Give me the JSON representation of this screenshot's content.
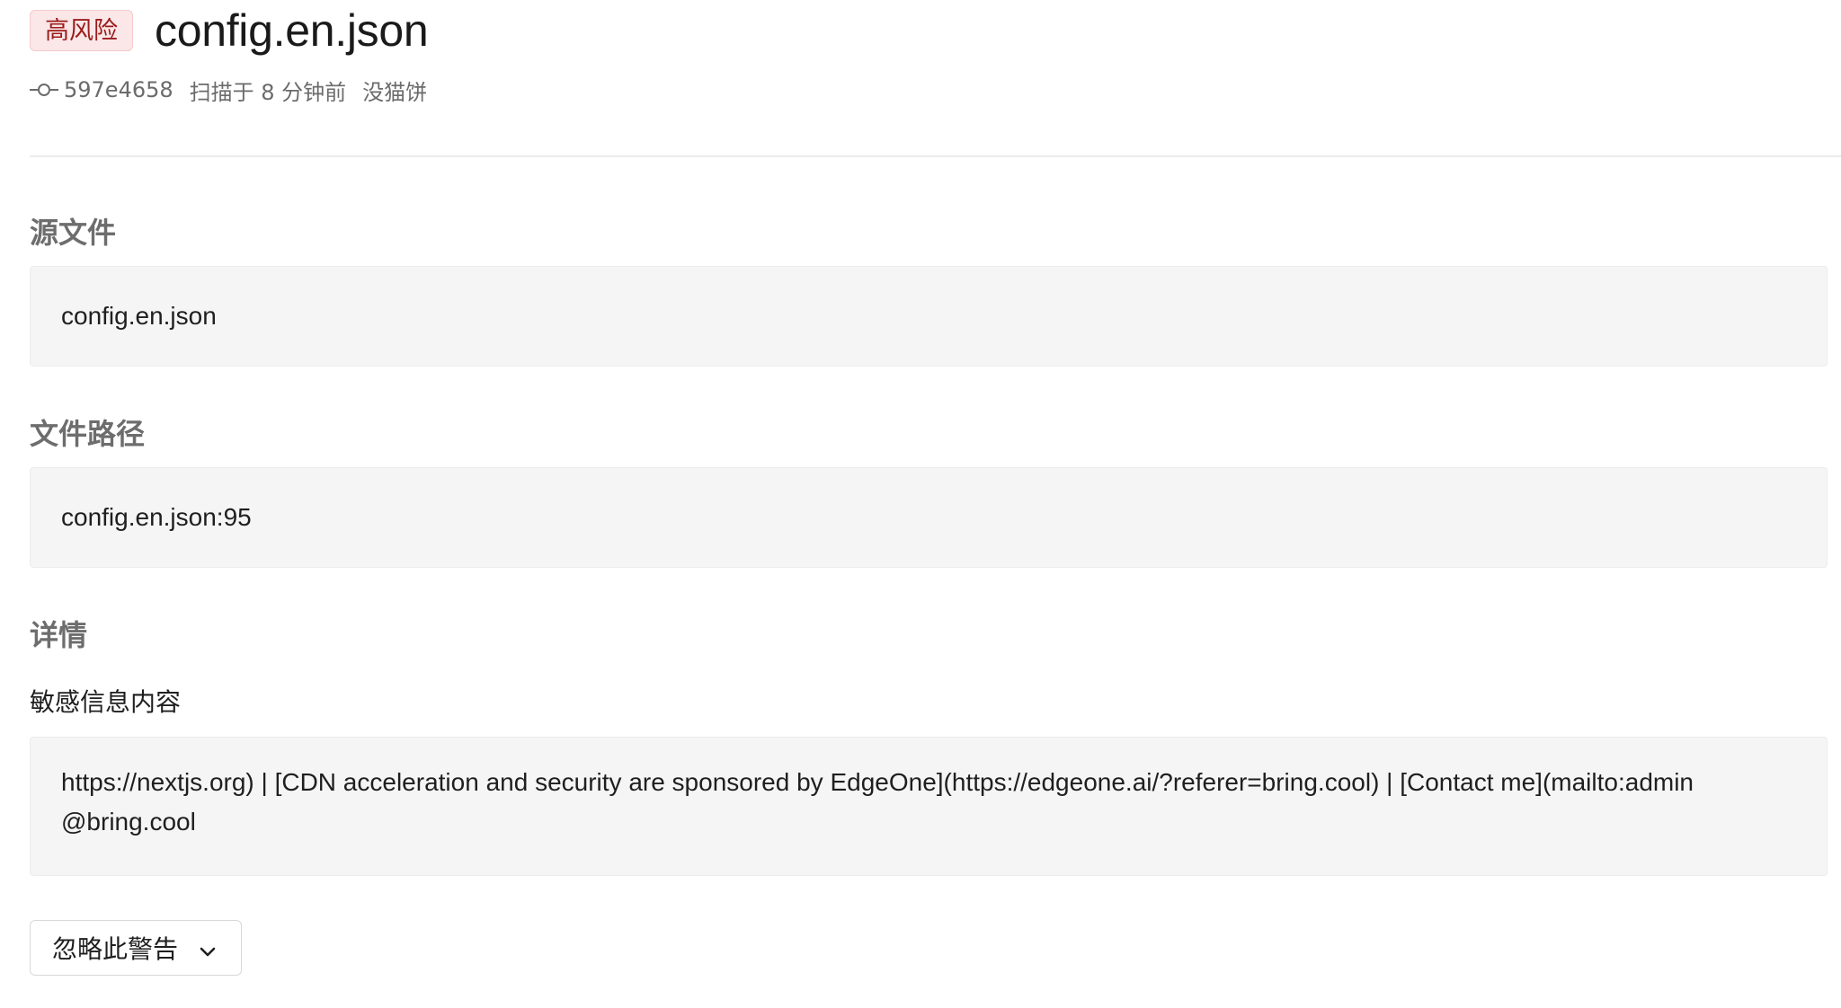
{
  "header": {
    "risk_badge": "高风险",
    "file_title": "config.en.json"
  },
  "meta": {
    "commit_icon": "commit-icon",
    "commit_hash": "597e4658",
    "scanned": "扫描于 8 分钟前",
    "author": "没猫饼"
  },
  "sections": {
    "source_file": {
      "title": "源文件",
      "value": "config.en.json"
    },
    "file_path": {
      "title": "文件路径",
      "value": "config.en.json:95"
    },
    "details": {
      "title": "详情",
      "subtitle": "敏感信息内容",
      "content": "https://nextjs.org) | [CDN acceleration and security are sponsored by EdgeOne](https://edgeone.ai/?referer=bring.cool) | [Contact me](mailto:admin@bring.cool"
    }
  },
  "actions": {
    "ignore_label": "忽略此警告",
    "ignore_icon": "chevron-down-icon"
  },
  "colors": {
    "badge_bg": "#fbe7e7",
    "badge_text": "#9b1c1c",
    "box_bg": "#f5f5f5",
    "muted_text": "#6d6d6d"
  }
}
